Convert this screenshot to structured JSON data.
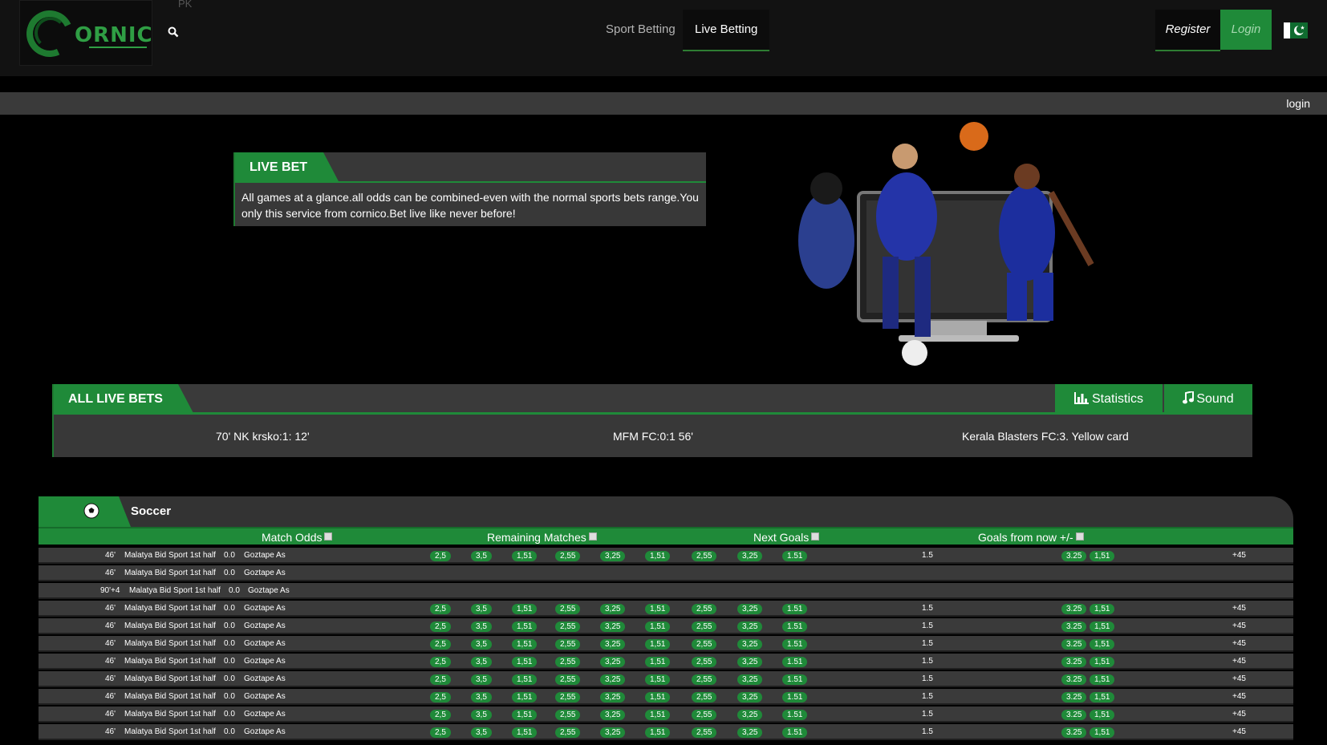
{
  "header": {
    "logo_text": "ORNIC",
    "region": "PK",
    "nav": [
      {
        "label": "Sport Betting"
      },
      {
        "label": "Live Betting"
      }
    ],
    "register_label": "Register",
    "login_label": "Login",
    "flag": "pakistan-flag-icon"
  },
  "subbar": {
    "login": "login"
  },
  "live_bet": {
    "title": "LIVE BET",
    "text": "All games at a glance.all odds can be combined-even with the normal sports bets range.You only this service from cornico.Bet live like never before!"
  },
  "all_live_bets": {
    "title": "ALL LIVE BETS",
    "statistics_label": "Statistics",
    "sound_label": "Sound",
    "ticker": [
      "70' NK krsko:1: 12'",
      "MFM FC:0:1 56'",
      "Kerala Blasters FC:3. Yellow card"
    ]
  },
  "soccer": {
    "title": "Soccer",
    "columns": [
      "Match Odds",
      "Remaining Matches",
      "Next Goals",
      "Goals from now +/-"
    ],
    "rows": [
      {
        "time": "46'",
        "home": "Malatya Bid Sport 1st half",
        "score": "0.0",
        "away": "Goztape As",
        "odds": [
          "2,5",
          "3,5",
          "1,51",
          "2,55",
          "3,25",
          "1,51",
          "2,55",
          "3,25",
          "1.51"
        ],
        "line": "1.5",
        "g1": "3.25",
        "g2": "1,51",
        "more": "+45"
      },
      {
        "time": "46'",
        "home": "Malatya Bid Sport 1st half",
        "score": "0.0",
        "away": "Goztape As",
        "odds": [],
        "line": "",
        "g1": "",
        "g2": "",
        "more": ""
      },
      {
        "time": "90'+4",
        "home": "Malatya Bid Sport 1st half",
        "score": "0.0",
        "away": "Goztape As",
        "odds": [],
        "line": "",
        "g1": "",
        "g2": "",
        "more": ""
      },
      {
        "time": "46'",
        "home": "Malatya Bid Sport 1st half",
        "score": "0.0",
        "away": "Goztape As",
        "odds": [
          "2,5",
          "3,5",
          "1,51",
          "2,55",
          "3,25",
          "1,51",
          "2,55",
          "3,25",
          "1.51"
        ],
        "line": "1.5",
        "g1": "3.25",
        "g2": "1,51",
        "more": "+45"
      },
      {
        "time": "46'",
        "home": "Malatya Bid Sport 1st half",
        "score": "0.0",
        "away": "Goztape As",
        "odds": [
          "2,5",
          "3,5",
          "1,51",
          "2,55",
          "3,25",
          "1,51",
          "2,55",
          "3,25",
          "1.51"
        ],
        "line": "1.5",
        "g1": "3.25",
        "g2": "1,51",
        "more": "+45"
      },
      {
        "time": "46'",
        "home": "Malatya Bid Sport 1st half",
        "score": "0.0",
        "away": "Goztape As",
        "odds": [
          "2,5",
          "3,5",
          "1,51",
          "2,55",
          "3,25",
          "1,51",
          "2,55",
          "3,25",
          "1.51"
        ],
        "line": "1.5",
        "g1": "3.25",
        "g2": "1,51",
        "more": "+45"
      },
      {
        "time": "46'",
        "home": "Malatya Bid Sport 1st half",
        "score": "0.0",
        "away": "Goztape As",
        "odds": [
          "2,5",
          "3,5",
          "1,51",
          "2,55",
          "3,25",
          "1,51",
          "2,55",
          "3,25",
          "1.51"
        ],
        "line": "1.5",
        "g1": "3.25",
        "g2": "1,51",
        "more": "+45"
      },
      {
        "time": "46'",
        "home": "Malatya Bid Sport 1st half",
        "score": "0.0",
        "away": "Goztape As",
        "odds": [
          "2,5",
          "3,5",
          "1,51",
          "2,55",
          "3,25",
          "1,51",
          "2,55",
          "3,25",
          "1.51"
        ],
        "line": "1.5",
        "g1": "3.25",
        "g2": "1,51",
        "more": "+45"
      },
      {
        "time": "46'",
        "home": "Malatya Bid Sport 1st half",
        "score": "0.0",
        "away": "Goztape As",
        "odds": [
          "2,5",
          "3,5",
          "1,51",
          "2,55",
          "3,25",
          "1,51",
          "2,55",
          "3,25",
          "1.51"
        ],
        "line": "1.5",
        "g1": "3.25",
        "g2": "1,51",
        "more": "+45"
      },
      {
        "time": "46'",
        "home": "Malatya Bid Sport 1st half",
        "score": "0.0",
        "away": "Goztape As",
        "odds": [
          "2,5",
          "3,5",
          "1,51",
          "2,55",
          "3,25",
          "1,51",
          "2,55",
          "3,25",
          "1.51"
        ],
        "line": "1.5",
        "g1": "3.25",
        "g2": "1,51",
        "more": "+45"
      },
      {
        "time": "46'",
        "home": "Malatya Bid Sport 1st half",
        "score": "0.0",
        "away": "Goztape As",
        "odds": [
          "2,5",
          "3,5",
          "1,51",
          "2,55",
          "3,25",
          "1,51",
          "2,55",
          "3,25",
          "1.51"
        ],
        "line": "1.5",
        "g1": "3.25",
        "g2": "1,51",
        "more": "+45"
      }
    ]
  },
  "colors": {
    "accent": "#1f8a39",
    "panel": "#3a3a3a",
    "background": "#000000"
  }
}
